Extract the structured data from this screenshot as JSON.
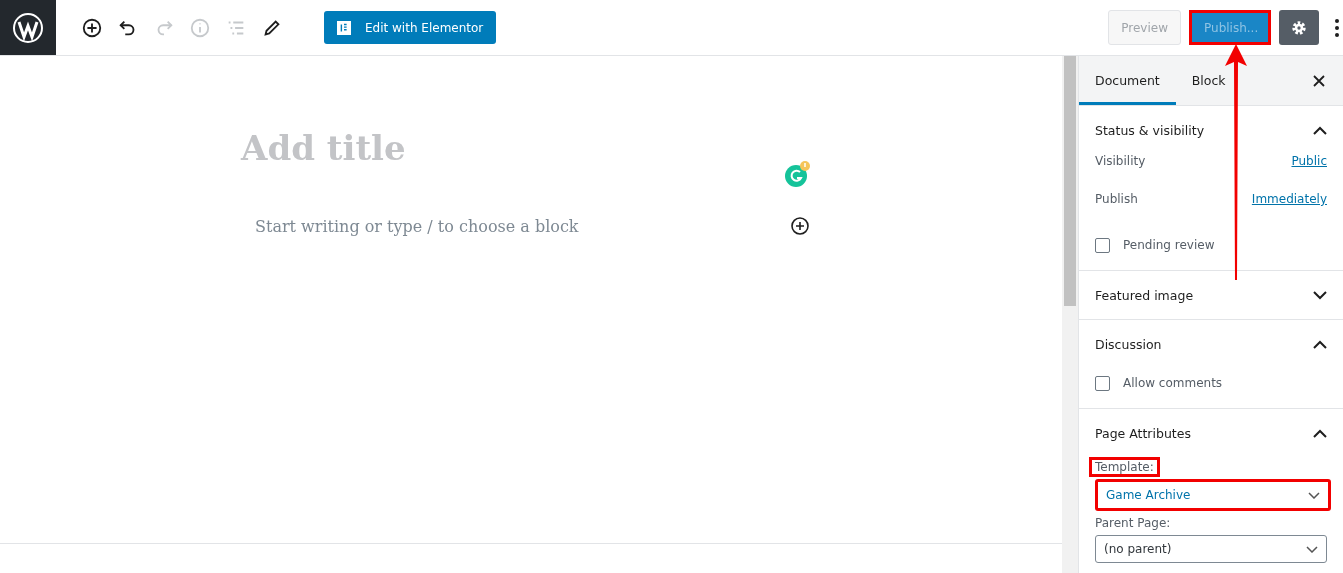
{
  "toolbar": {
    "tools": [
      {
        "kind": "add",
        "disabled": false
      },
      {
        "kind": "undo",
        "disabled": false
      },
      {
        "kind": "redo",
        "disabled": true
      },
      {
        "kind": "info",
        "disabled": true
      },
      {
        "kind": "outline",
        "disabled": true
      },
      {
        "kind": "edit",
        "disabled": false
      }
    ],
    "elementor_button": "Edit with Elementor",
    "preview_button": "Preview",
    "publish_button": {
      "label": "Publish...",
      "highlighted": true
    }
  },
  "editor": {
    "title_placeholder": "Add title",
    "block_placeholder": "Start writing or type / to choose a block"
  },
  "sidebar": {
    "tabs": [
      {
        "label": "Document",
        "selected": true
      },
      {
        "label": "Block",
        "selected": false
      }
    ],
    "panels": [
      {
        "title": "Status & visibility",
        "expanded": true,
        "rows": [
          {
            "kind": "link",
            "label": "Visibility",
            "value": "Public"
          },
          {
            "kind": "link",
            "label": "Publish",
            "value": "Immediately"
          },
          {
            "kind": "checkbox",
            "label": "Pending review",
            "checked": false
          }
        ]
      },
      {
        "title": "Featured image",
        "expanded": false
      },
      {
        "title": "Discussion",
        "expanded": true,
        "rows": [
          {
            "kind": "checkbox",
            "label": "Allow comments",
            "checked": false
          }
        ]
      },
      {
        "title": "Page Attributes",
        "expanded": true,
        "rows": [
          {
            "kind": "select",
            "label": "Template:",
            "value": "Game Archive",
            "highlighted": true
          },
          {
            "kind": "select",
            "label": "Parent Page:",
            "value": "(no parent)",
            "highlighted": false
          }
        ]
      }
    ]
  }
}
